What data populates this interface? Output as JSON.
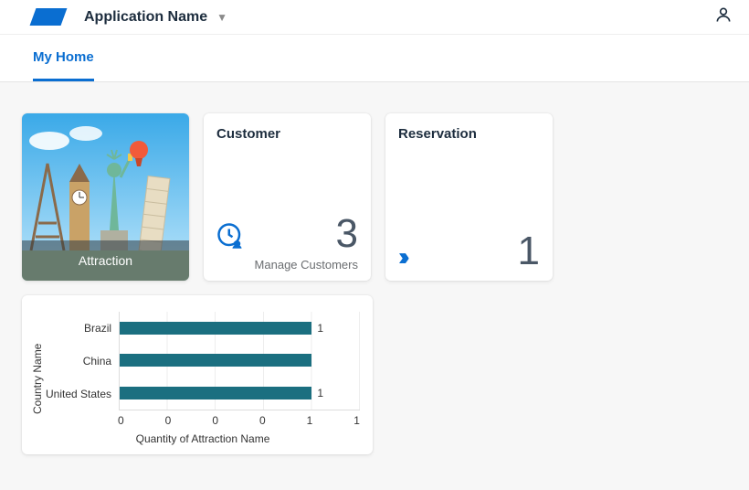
{
  "header": {
    "app_name": "Application Name"
  },
  "tabs": {
    "my_home": "My Home"
  },
  "cards": {
    "attraction": {
      "caption": "Attraction"
    },
    "customer": {
      "title": "Customer",
      "value": "3",
      "footer": "Manage Customers"
    },
    "reservation": {
      "title": "Reservation",
      "value": "1"
    }
  },
  "chart_data": {
    "type": "bar",
    "orientation": "horizontal",
    "categories": [
      "Brazil",
      "China",
      "United States"
    ],
    "values": [
      1,
      1,
      1
    ],
    "value_labels": [
      "1",
      "",
      "1"
    ],
    "xticks": [
      "0",
      "0",
      "0",
      "0",
      "1",
      "1"
    ],
    "xlabel": "Quantity of Attraction Name",
    "ylabel": "Country Name",
    "xlim": [
      0,
      1.25
    ]
  }
}
